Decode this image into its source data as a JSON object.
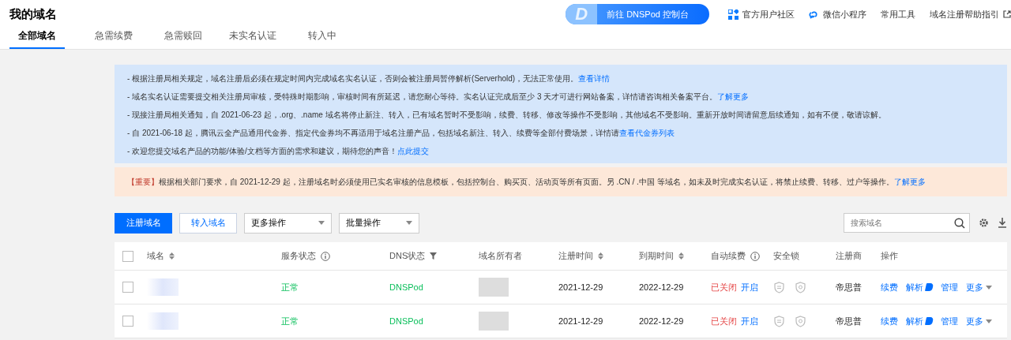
{
  "page_title": "我的域名",
  "header_button": {
    "logo": "D",
    "label": "前往 DNSPod 控制台"
  },
  "header_links": [
    {
      "label": "官方用户社区",
      "kind": "grid"
    },
    {
      "label": "微信小程序",
      "kind": "link"
    },
    {
      "label": "常用工具",
      "kind": "plain"
    },
    {
      "label": "域名注册帮助指引",
      "kind": "external"
    }
  ],
  "tabs": [
    {
      "label": "全部域名",
      "selected": true
    },
    {
      "label": "急需续费",
      "selected": false
    },
    {
      "label": "急需赎回",
      "selected": false
    },
    {
      "label": "未实名认证",
      "selected": false
    },
    {
      "label": "转入中",
      "selected": false
    }
  ],
  "notices": [
    {
      "text": "- 根据注册局相关规定，域名注册后必须在规定时间内完成域名实名认证，否则会被注册局暂停解析(Serverhold)，无法正常使用。",
      "link": "查看详情"
    },
    {
      "text": "- 域名实名认证需要提交相关注册局审核，受特殊时期影响，审核时间有所延迟，请您耐心等待。实名认证完成后至少 3 天才可进行网站备案，详情请咨询相关备案平台。",
      "link": "了解更多"
    },
    {
      "text": "- 现接注册局相关通知，自 2021-06-23 起，.org、.name 域名将停止新注、转入，已有域名暂时不受影响，续费、转移、修改等操作不受影响，其他域名不受影响。重新开放时间请留意后续通知，如有不便，敬请谅解。"
    },
    {
      "text": "- 自 2021-06-18 起，腾讯云全产品通用代金券、指定代金券均不再适用于域名注册产品，包括域名新注、转入、续费等全部付费场景，详情请",
      "link": "查看代金券列表"
    },
    {
      "text": "- 欢迎您提交域名产品的功能/体验/文档等方面的需求和建议，期待您的声音！",
      "link": "点此提交"
    }
  ],
  "important": {
    "tag": "【重要】",
    "text": "根据相关部门要求，自 2021-12-29 起，注册域名时必须使用已实名审核的信息模板，包括控制台、购买页、活动页等所有页面。另 .CN / .中国 等域名，如未及时完成实名认证，将禁止续费、转移、过户等操作。",
    "link": "了解更多"
  },
  "toolbar": {
    "primary": "注册域名",
    "secondary": "转入域名",
    "dropdowns": [
      "更多操作",
      "批量操作"
    ],
    "search": {
      "placeholder": "搜索域名"
    }
  },
  "table": {
    "all_checked": false,
    "columns": [
      {
        "label": "域名",
        "kind": "sort"
      },
      {
        "label": "服务状态",
        "kind": "info"
      },
      {
        "label": "DNS状态",
        "kind": "filter"
      },
      {
        "label": "域名所有者",
        "kind": "plain"
      },
      {
        "label": "注册时间",
        "kind": "sort"
      },
      {
        "label": "到期时间",
        "kind": "sort"
      },
      {
        "label": "自动续费",
        "kind": "info"
      },
      {
        "label": "安全锁",
        "kind": "plain"
      },
      {
        "label": "注册商",
        "kind": "plain"
      },
      {
        "label": "操作",
        "kind": "plain"
      }
    ],
    "rows": [
      {
        "checked": false,
        "service_status": "正常",
        "dns_status": "DNSPod",
        "registered": "2021-12-29",
        "expires": "2022-12-29",
        "auto_renew": "已关闭",
        "auto_renew_action": "开启",
        "registrar": "帝思普",
        "actions": [
          "续费",
          "解析",
          "管理",
          "更多"
        ]
      },
      {
        "checked": false,
        "service_status": "正常",
        "dns_status": "DNSPod",
        "registered": "2021-12-29",
        "expires": "2022-12-29",
        "auto_renew": "已关闭",
        "auto_renew_action": "开启",
        "registrar": "帝思普",
        "actions": [
          "续费",
          "解析",
          "管理",
          "更多"
        ]
      }
    ]
  }
}
